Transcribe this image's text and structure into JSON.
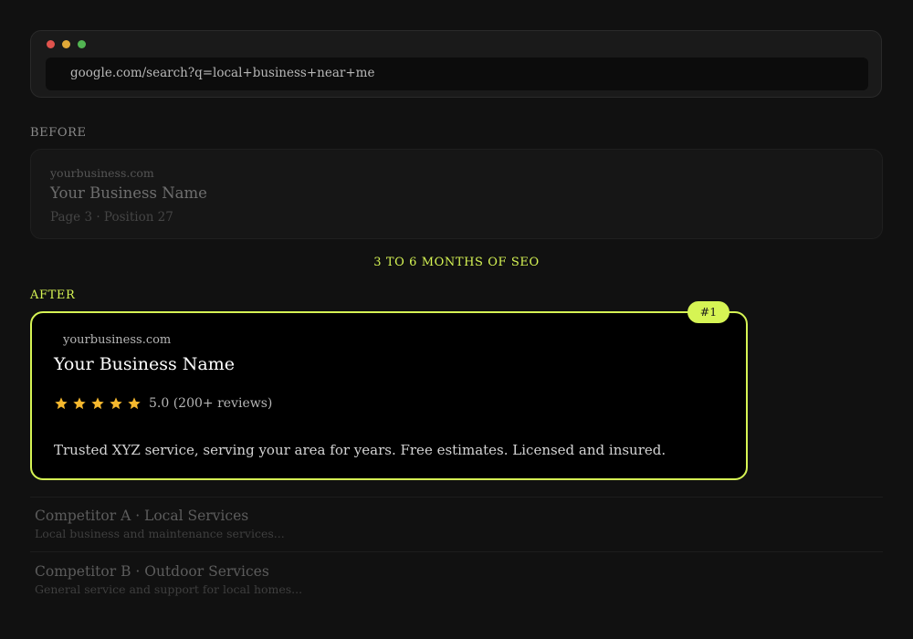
{
  "browser": {
    "url": "google.com/search?q=local+business+near+me"
  },
  "before": {
    "label": "BEFORE",
    "url": "yourbusiness.com",
    "title": "Your Business Name",
    "position": "Page 3 · Position 27"
  },
  "transition": "3 TO 6 MONTHS OF SEO",
  "after": {
    "label": "AFTER",
    "badge": "#1",
    "url": "yourbusiness.com",
    "title": "Your Business Name",
    "stars": 5,
    "rating": "5.0 (200+ reviews)",
    "description": "Trusted XYZ service, serving your area for years. Free estimates. Licensed and insured."
  },
  "competitors": [
    {
      "title": "Competitor A · Local Services",
      "description": "Local business and maintenance services..."
    },
    {
      "title": "Competitor B · Outdoor Services",
      "description": "General service and support for local homes..."
    }
  ],
  "colors": {
    "accent": "#d6f454",
    "star": "#f5b82e",
    "background": "#111111"
  }
}
